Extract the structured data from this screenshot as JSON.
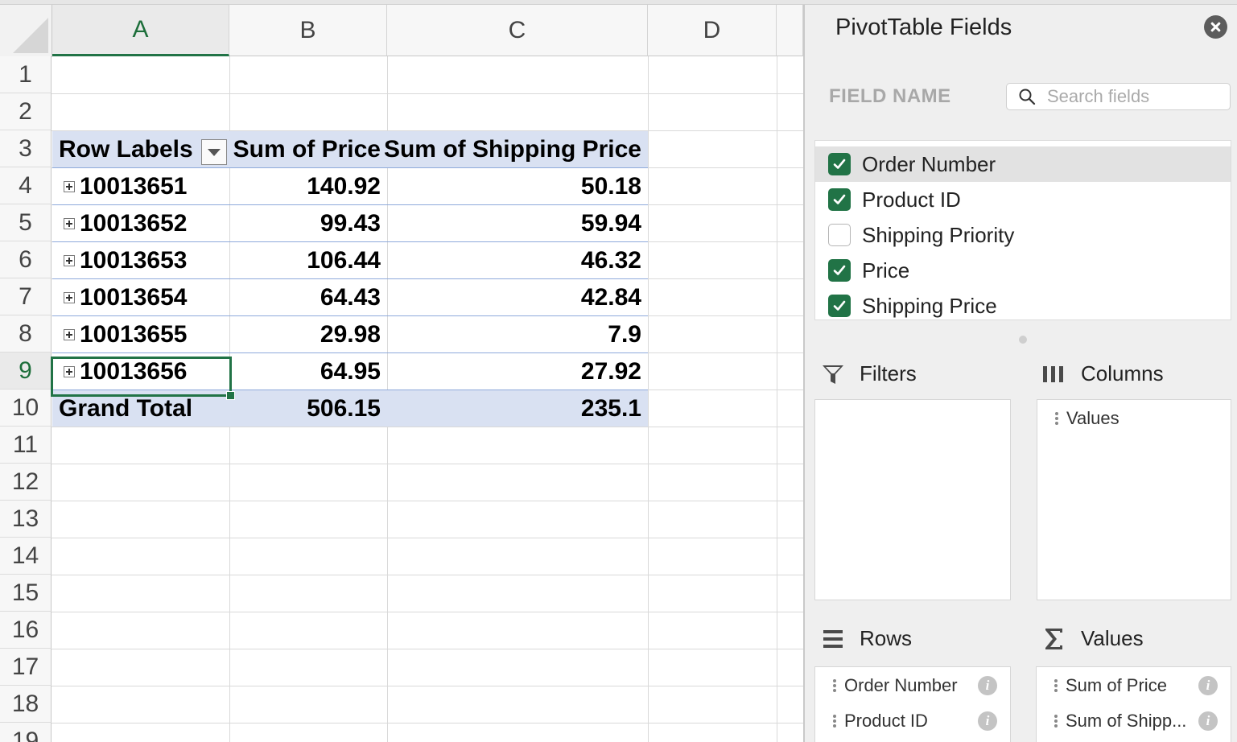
{
  "sheet": {
    "columns": [
      "A",
      "B",
      "C",
      "D"
    ],
    "active_column": "A",
    "rows": [
      "1",
      "2",
      "3",
      "4",
      "5",
      "6",
      "7",
      "8",
      "9",
      "10",
      "11",
      "12",
      "13",
      "14",
      "15",
      "16",
      "17",
      "18",
      "19"
    ],
    "active_row": "9",
    "pivot": {
      "headers": [
        "Row Labels",
        "Sum of Price",
        "Sum of Shipping Price"
      ],
      "rows": [
        {
          "label": "10013651",
          "price": "140.92",
          "shipping": "50.18"
        },
        {
          "label": "10013652",
          "price": "99.43",
          "shipping": "59.94"
        },
        {
          "label": "10013653",
          "price": "106.44",
          "shipping": "46.32"
        },
        {
          "label": "10013654",
          "price": "64.43",
          "shipping": "42.84"
        },
        {
          "label": "10013655",
          "price": "29.98",
          "shipping": "7.9"
        },
        {
          "label": "10013656",
          "price": "64.95",
          "shipping": "27.92"
        }
      ],
      "total": {
        "label": "Grand Total",
        "price": "506.15",
        "shipping": "235.1"
      }
    }
  },
  "panel": {
    "title": "PivotTable Fields",
    "field_name_label": "FIELD NAME",
    "search_placeholder": "Search fields",
    "fields": [
      {
        "label": "Order Number",
        "checked": true
      },
      {
        "label": "Product ID",
        "checked": true
      },
      {
        "label": "Shipping Priority",
        "checked": false
      },
      {
        "label": "Price",
        "checked": true
      },
      {
        "label": "Shipping Price",
        "checked": true
      }
    ],
    "filters": {
      "title": "Filters",
      "items": []
    },
    "columns": {
      "title": "Columns",
      "items": [
        "Values"
      ]
    },
    "rows": {
      "title": "Rows",
      "items": [
        "Order Number",
        "Product ID"
      ]
    },
    "values": {
      "title": "Values",
      "items": [
        "Sum of Price",
        "Sum of Shipp..."
      ]
    }
  },
  "colors": {
    "accent": "#217346",
    "pivot_band": "#d9e1f2",
    "pivot_separator": "#8ea9db"
  }
}
